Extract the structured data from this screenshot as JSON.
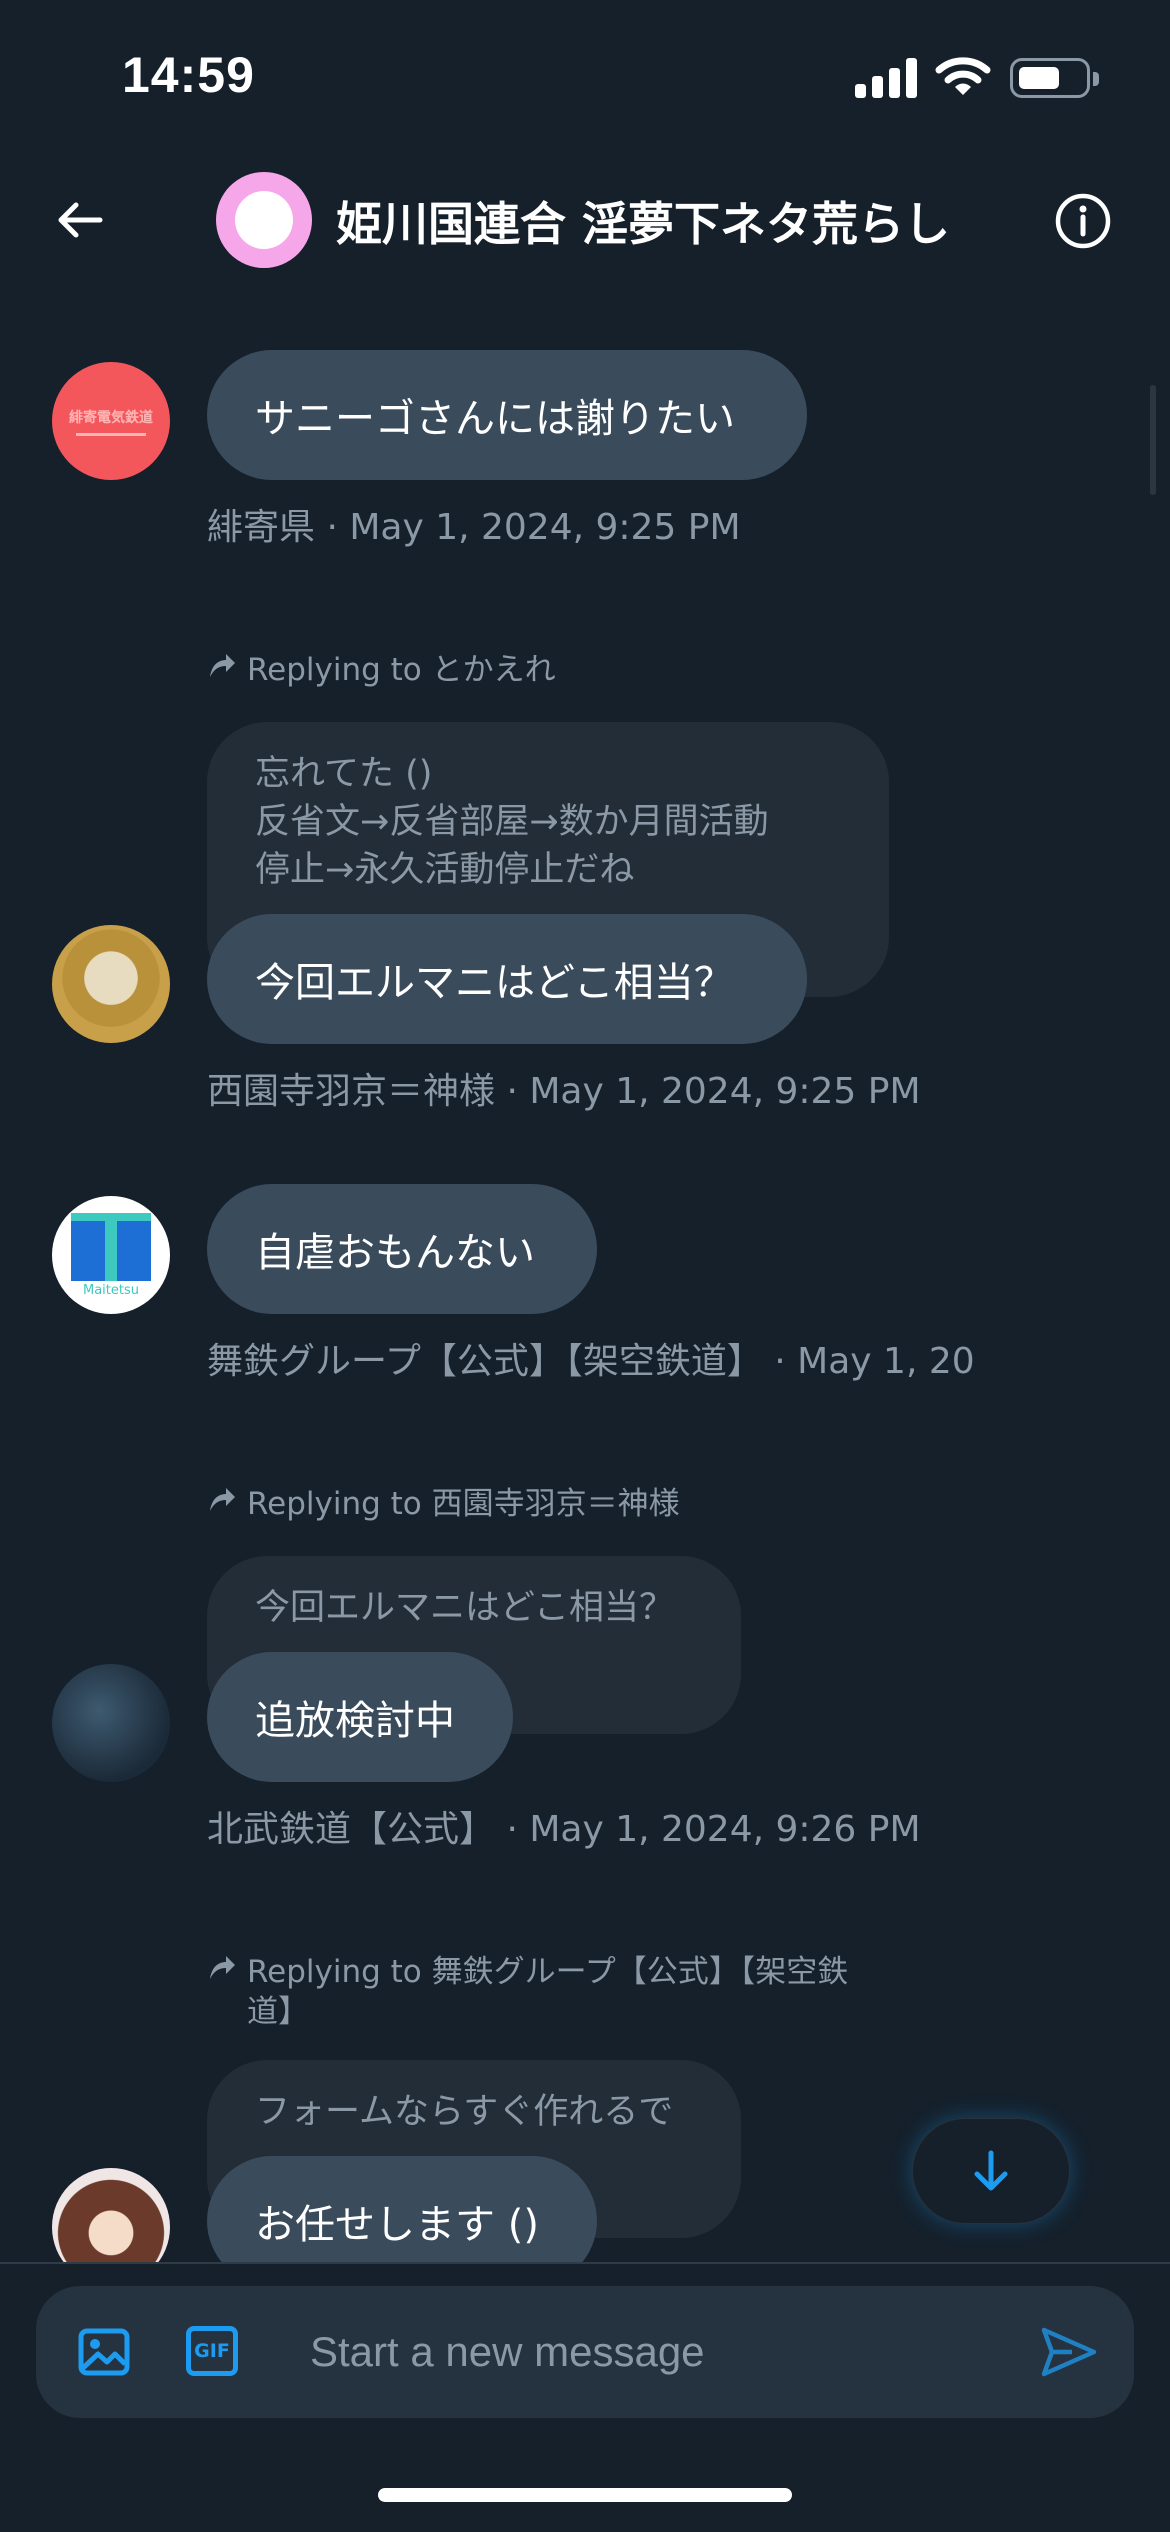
{
  "status_bar": {
    "time": "14:59"
  },
  "header": {
    "title": "姫川国連合 淫夢下ネタ荒らし",
    "back_icon": "arrow-left-icon",
    "info_icon": "info-icon"
  },
  "messages": [
    {
      "text": "サニーゴさんには謝りたい",
      "meta": "緋寄県 · May 1, 2024, 9:25 PM",
      "avatar_color": "#f4575b",
      "avatar_caption": "緋寄電気鉄道"
    },
    {
      "reply_label": "Replying to とかえれ",
      "quoted": "忘れてた ()\n反省文→反省部屋→数か月間活動\n停止→永久活動停止だね",
      "text": "今回エルマニはどこ相当？",
      "meta": "西園寺羽京＝神様 · May 1, 2024, 9:25 PM"
    },
    {
      "text": "自虐おもんない",
      "meta": "舞鉄グループ【公式】【架空鉄道】 · May 1, 20",
      "avatar_caption": "Maitetsu"
    },
    {
      "reply_label": "Replying to 西園寺羽京＝神様",
      "quoted": "今回エルマニはどこ相当？",
      "text": "追放検討中",
      "meta": "北武鉄道【公式】 · May 1, 2024, 9:26 PM"
    },
    {
      "reply_label": "Replying to 舞鉄グループ【公式】【架空鉄\n道】",
      "quoted": "フォームならすぐ作れるで",
      "text": "お任せします ()"
    }
  ],
  "composer": {
    "placeholder": "Start a new message",
    "gif_label": "GIF",
    "image_icon": "image-icon",
    "send_icon": "send-icon"
  },
  "colors": {
    "accent": "#1d9bf0",
    "background": "#15202b",
    "bubble": "#3a4b5c",
    "quoted_bubble": "#222d38",
    "muted_text": "#8b98a5"
  }
}
